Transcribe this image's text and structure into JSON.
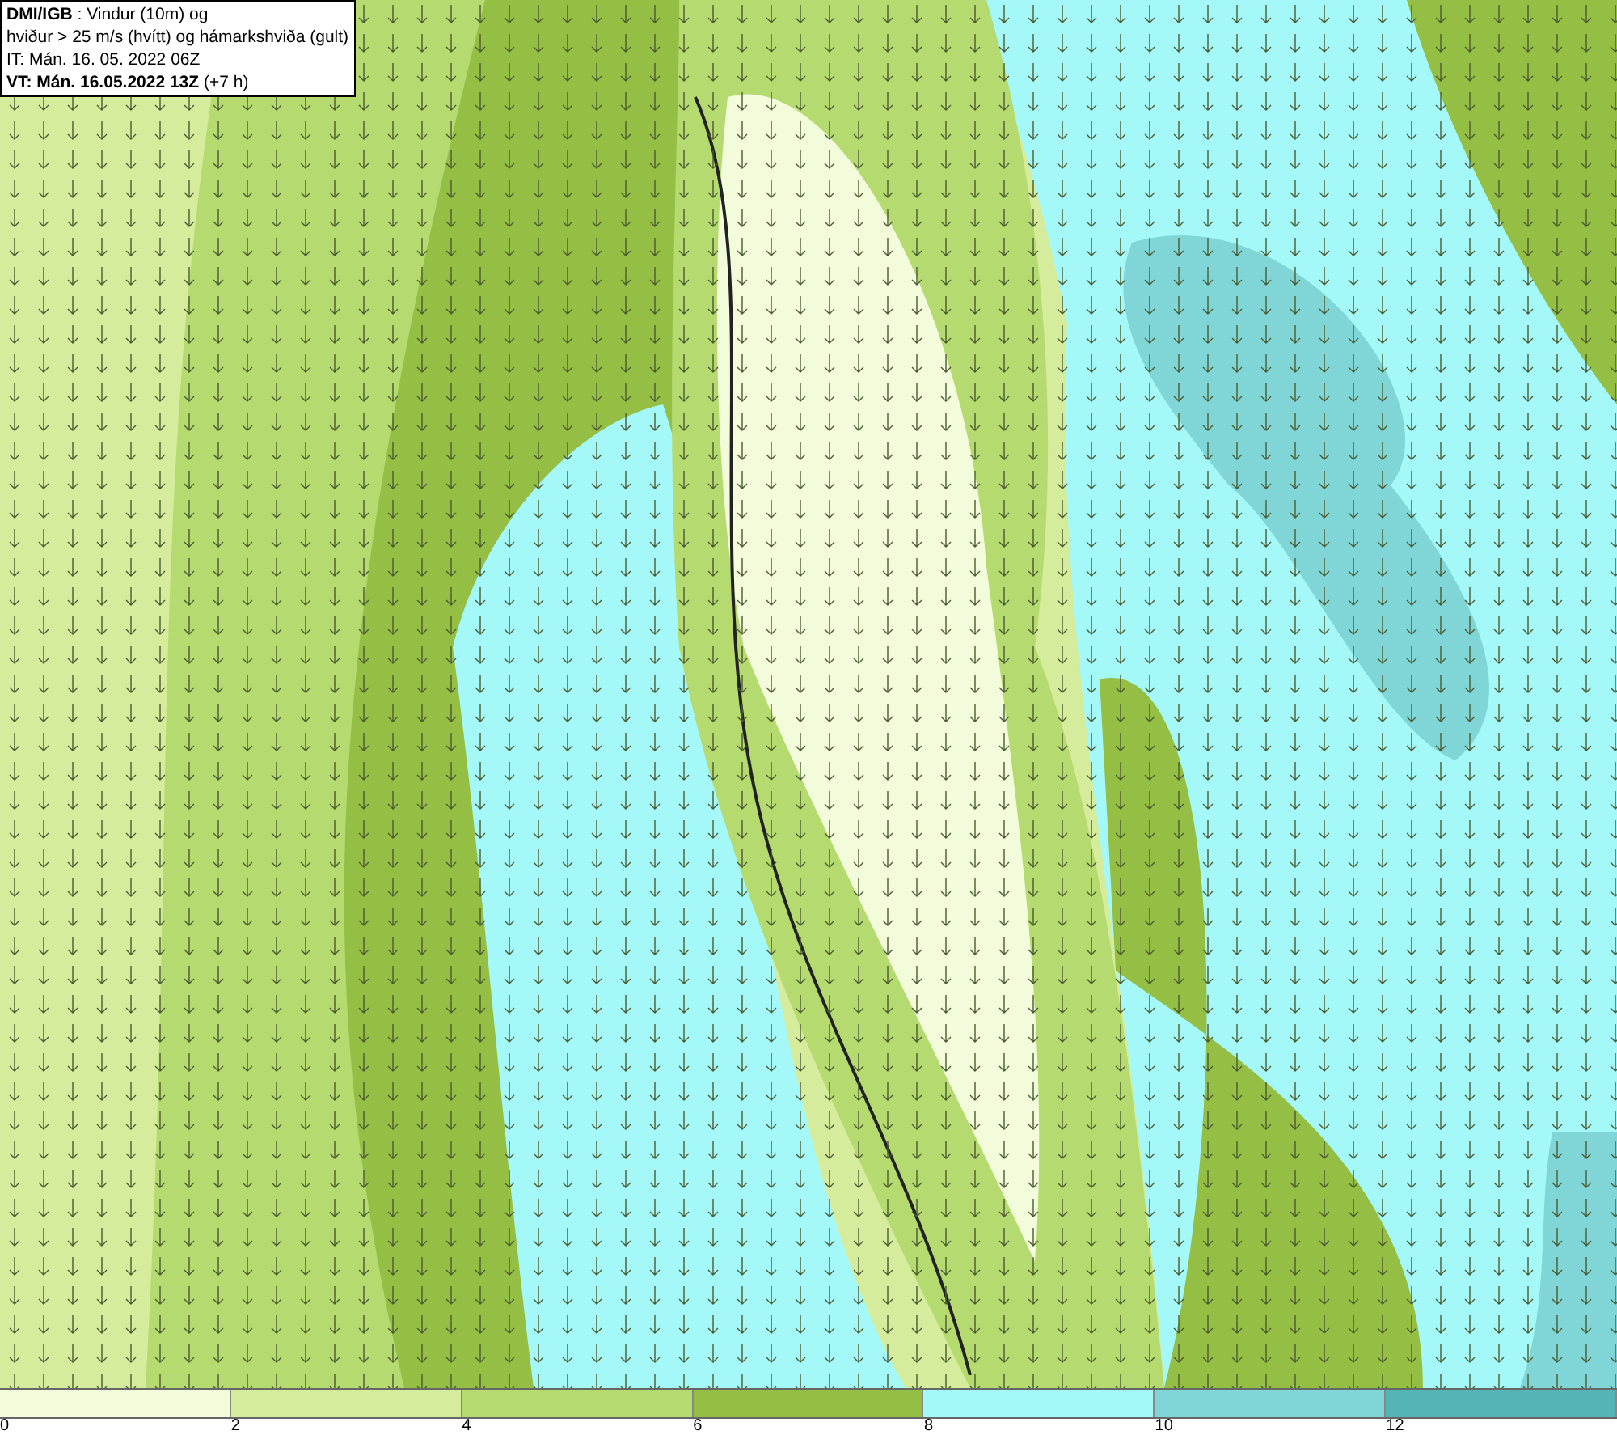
{
  "title_box": {
    "lines": [
      "**DMI/IGB** : Vindur (10m) og",
      "hviður > 25 m/s (hvítt) og hámarkshviða (gult)",
      "IT: Mán. 16. 05. 2022 06Z",
      "**VT: Mán. 16.05.2022 13Z** (+7 h)"
    ]
  },
  "legend": {
    "bins": [
      {
        "color": "#f2fbda"
      },
      {
        "color": "#d5ec9c"
      },
      {
        "color": "#b5da70"
      },
      {
        "color": "#94bf44"
      },
      {
        "color": "#a4f8f8"
      },
      {
        "color": "#80d6d6"
      },
      {
        "color": "#55b4b4"
      }
    ],
    "ticks": [
      "0",
      "2",
      "4",
      "6",
      "8",
      "10",
      "12"
    ]
  }
}
